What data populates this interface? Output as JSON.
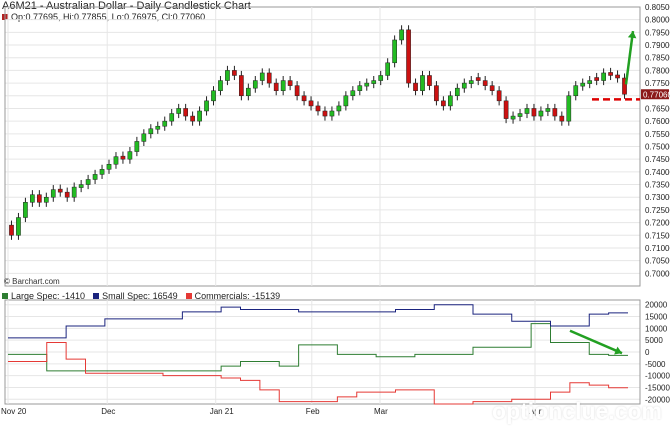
{
  "title": "A6M21 - Australian Dollar - Daily Candlestick Chart",
  "ohlc_text": "Op:0.77695, Hi:0.77855, Lo:0.76975, Cl:0.77060",
  "credit": "© Barchart.com",
  "watermark": "optionclue.com",
  "colors": {
    "up": "#22bb22",
    "down": "#cc1111",
    "large_spec": "#2e7d32",
    "small_spec": "#1a237e",
    "commercials": "#e53935",
    "arrow": "#22a022",
    "support": "#dd0000",
    "last_price_box": "#8b1a1a"
  },
  "chart_data": [
    {
      "type": "candlestick",
      "title": "A6M21 - Australian Dollar - Daily Candlestick Chart",
      "x_ticks": [
        "Nov 20",
        "Dec",
        "Jan 21",
        "Feb",
        "Mar",
        "Apr"
      ],
      "ylim": [
        0.695,
        0.805
      ],
      "y_ticks": [
        "0.80500",
        "0.80000",
        "0.79500",
        "0.79000",
        "0.78500",
        "0.78000",
        "0.77500",
        "0.77000",
        "0.76500",
        "0.76000",
        "0.75500",
        "0.75000",
        "0.74500",
        "0.74000",
        "0.73500",
        "0.73000",
        "0.72500",
        "0.72000",
        "0.71500",
        "0.71000",
        "0.70500",
        "0.70000"
      ],
      "y_tick_values": [
        0.805,
        0.8,
        0.795,
        0.79,
        0.785,
        0.78,
        0.775,
        0.77,
        0.765,
        0.76,
        0.755,
        0.75,
        0.745,
        0.74,
        0.735,
        0.73,
        0.725,
        0.72,
        0.715,
        0.71,
        0.705,
        0.7
      ],
      "last_price_label": "0.77060",
      "last_price": 0.7706,
      "support_level": 0.7686,
      "candles_close": [
        0.715,
        0.722,
        0.728,
        0.731,
        0.728,
        0.73,
        0.733,
        0.732,
        0.73,
        0.734,
        0.735,
        0.737,
        0.739,
        0.741,
        0.743,
        0.746,
        0.745,
        0.748,
        0.752,
        0.755,
        0.757,
        0.758,
        0.76,
        0.763,
        0.765,
        0.762,
        0.76,
        0.764,
        0.768,
        0.772,
        0.776,
        0.78,
        0.778,
        0.77,
        0.773,
        0.776,
        0.779,
        0.775,
        0.772,
        0.776,
        0.774,
        0.77,
        0.768,
        0.766,
        0.764,
        0.762,
        0.764,
        0.766,
        0.77,
        0.772,
        0.774,
        0.775,
        0.776,
        0.778,
        0.783,
        0.792,
        0.796,
        0.775,
        0.772,
        0.778,
        0.774,
        0.768,
        0.766,
        0.77,
        0.773,
        0.775,
        0.776,
        0.776,
        0.774,
        0.772,
        0.768,
        0.761,
        0.762,
        0.763,
        0.765,
        0.762,
        0.764,
        0.765,
        0.762,
        0.76,
        0.77,
        0.774,
        0.775,
        0.776,
        0.776,
        0.779,
        0.778,
        0.777,
        0.7706
      ],
      "candles_up": [
        false,
        true,
        true,
        true,
        false,
        true,
        true,
        false,
        false,
        true,
        true,
        true,
        true,
        true,
        true,
        true,
        false,
        true,
        true,
        true,
        true,
        true,
        true,
        true,
        true,
        false,
        false,
        true,
        true,
        true,
        true,
        true,
        false,
        false,
        true,
        true,
        true,
        false,
        false,
        true,
        false,
        false,
        false,
        false,
        false,
        false,
        true,
        true,
        true,
        true,
        true,
        true,
        true,
        true,
        true,
        true,
        true,
        false,
        false,
        true,
        false,
        false,
        false,
        true,
        true,
        true,
        true,
        false,
        false,
        false,
        false,
        false,
        true,
        true,
        true,
        false,
        true,
        true,
        false,
        false,
        true,
        true,
        true,
        true,
        false,
        true,
        false,
        false,
        false
      ]
    },
    {
      "type": "line",
      "x_ticks": [
        "Nov 20",
        "Dec",
        "Jan 21",
        "Feb",
        "Mar",
        "Apr"
      ],
      "ylim": [
        -22000,
        22000
      ],
      "y_ticks": [
        "20000",
        "15000",
        "10000",
        "5000",
        "0",
        "-5000",
        "-10000",
        "-15000",
        "-20000"
      ],
      "y_tick_values": [
        20000,
        15000,
        10000,
        5000,
        0,
        -5000,
        -10000,
        -15000,
        -20000
      ],
      "series": [
        {
          "name": "Large Spec: -1410",
          "values": [
            -1000,
            -1000,
            -8000,
            -8000,
            -8000,
            -8000,
            -8000,
            -8000,
            -8000,
            -8000,
            -8000,
            -6000,
            -4000,
            -4000,
            -6000,
            3000,
            3000,
            -1000,
            -1000,
            -2000,
            -2000,
            -1000,
            -1000,
            -1000,
            2000,
            2000,
            2000,
            12000,
            4000,
            4000,
            -1000,
            -1410
          ]
        },
        {
          "name": "Small Spec: 16549",
          "values": [
            6000,
            6000,
            6000,
            11000,
            11000,
            14000,
            14000,
            14000,
            14000,
            17000,
            17000,
            19000,
            18000,
            18000,
            18000,
            17000,
            17000,
            17000,
            17000,
            17000,
            18000,
            18000,
            20000,
            20000,
            16000,
            16000,
            13000,
            13000,
            11000,
            11000,
            16000,
            16549
          ]
        },
        {
          "name": "Commercials: -15139",
          "values": [
            -4000,
            -4000,
            4000,
            -3000,
            -9000,
            -9000,
            -9000,
            -9000,
            -10000,
            -10000,
            -10000,
            -11000,
            -12000,
            -16000,
            -21000,
            -21000,
            -21000,
            -19000,
            -17000,
            -17000,
            -16000,
            -16000,
            -22000,
            -22000,
            -21000,
            -21000,
            -20000,
            -20000,
            -17000,
            -13000,
            -14000,
            -15139
          ]
        }
      ]
    }
  ]
}
